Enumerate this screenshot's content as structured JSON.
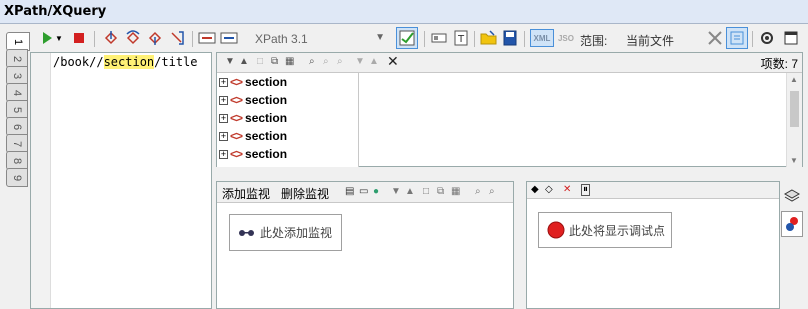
{
  "window": {
    "title": "XPath/XQuery"
  },
  "tabs": [
    "1",
    "2",
    "3",
    "4",
    "5",
    "6",
    "7",
    "8",
    "9"
  ],
  "toolbar": {
    "version_select": "XPath 3.1",
    "xml_label": "XML",
    "json_label": "JSO",
    "scope_label": "范围:",
    "scope_value": "当前文件"
  },
  "editor": {
    "expression_before": "/book//",
    "expression_highlight": "section",
    "expression_after": "/title"
  },
  "results": {
    "count_label": "项数: 7",
    "rows": [
      "section",
      "section",
      "section",
      "section",
      "section"
    ],
    "expand_symbol": "+",
    "tag_symbol": "<>"
  },
  "watch": {
    "add_label": "添加监视",
    "delete_label": "删除监视",
    "hint": "此处添加监视"
  },
  "breakpoints": {
    "hint": "此处将显示调试点"
  },
  "colors": {
    "accent": "#4a90d9",
    "breakpoint": "#e02020",
    "tag": "#c0392b",
    "highlight": "#fff176"
  }
}
